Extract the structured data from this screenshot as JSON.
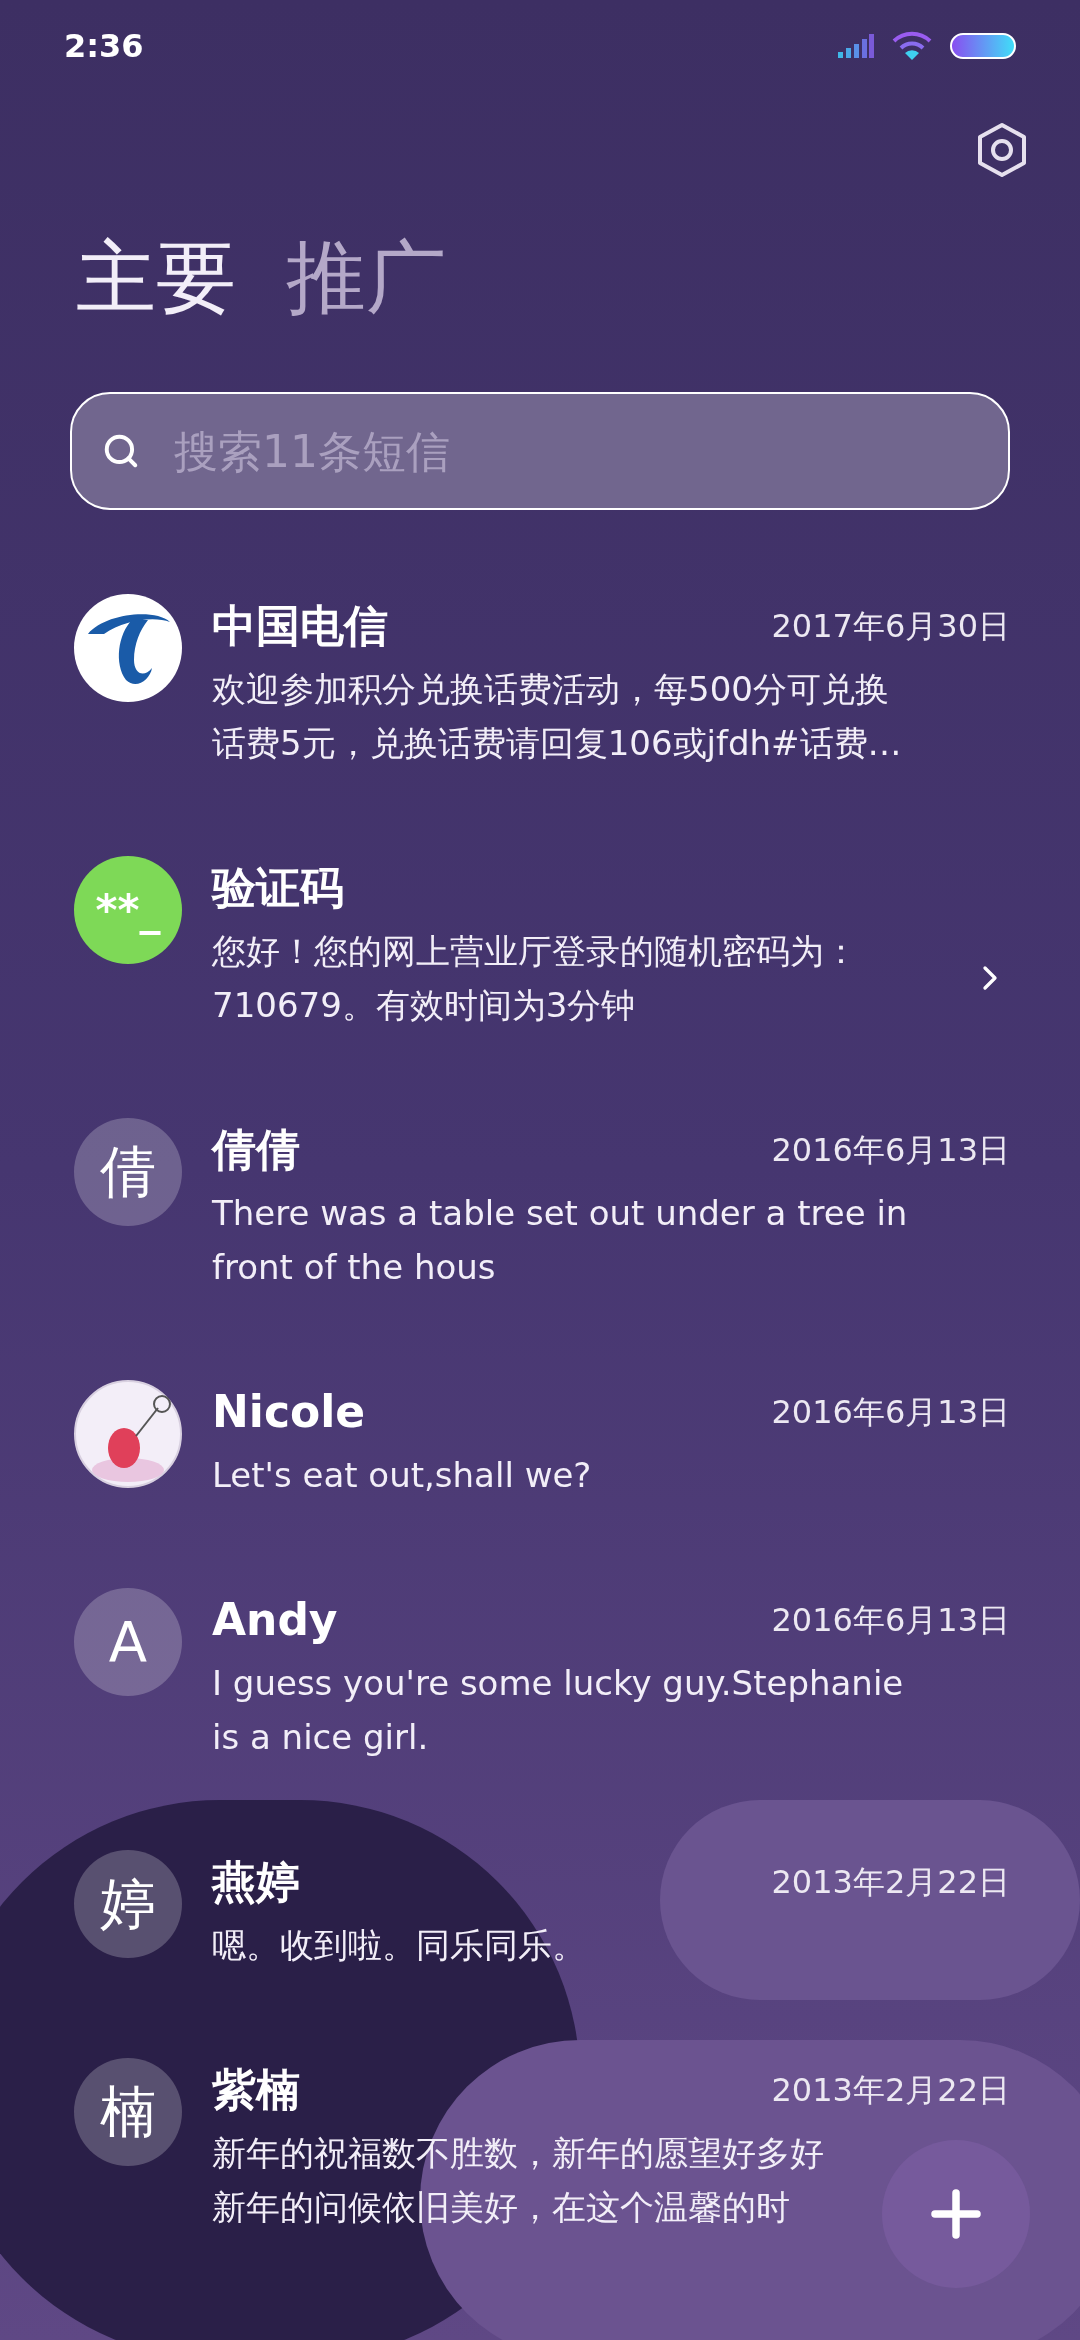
{
  "status_bar": {
    "time": "2:36"
  },
  "tabs": [
    {
      "label": "主要",
      "selected": true
    },
    {
      "label": "推广",
      "selected": false
    }
  ],
  "search": {
    "placeholder": "搜索11条短信"
  },
  "conversations": [
    {
      "avatar": {
        "kind": "logo"
      },
      "name": "中国电信",
      "date": "2017年6月30日",
      "message_lines": [
        "欢迎参加积分兑换话费活动，每500分可兑换",
        "话费5元，兑换话费请回复106或jfdh#话费…"
      ]
    },
    {
      "avatar": {
        "kind": "code",
        "text": "**_",
        "color": "#7ed957"
      },
      "name": "验证码",
      "message_lines": [
        "您好！您的网上营业厅登录的随机密码为：",
        "710679。有效时间为3分钟"
      ],
      "chevron": true
    },
    {
      "avatar": {
        "kind": "initial",
        "text": "倩"
      },
      "name": "倩倩",
      "date": "2016年6月13日",
      "message_lines": [
        "There was a table set out under a tree in",
        "front of the hous"
      ]
    },
    {
      "avatar": {
        "kind": "picture"
      },
      "name": "Nicole",
      "date": "2016年6月13日",
      "message_lines": [
        "Let's eat out,shall we?"
      ]
    },
    {
      "avatar": {
        "kind": "initial",
        "text": "A"
      },
      "name": "Andy",
      "date": "2016年6月13日",
      "message_lines": [
        "I guess you're some lucky guy.Stephanie",
        "is a nice girl."
      ]
    },
    {
      "avatar": {
        "kind": "initial",
        "text": "婷"
      },
      "name": "燕婷",
      "date": "2013年2月22日",
      "message_lines": [
        "嗯。收到啦。同乐同乐。"
      ]
    },
    {
      "avatar": {
        "kind": "initial",
        "text": "楠"
      },
      "name": "紫楠",
      "date": "2013年2月22日",
      "message_lines": [
        "新年的祝福数不胜数，新年的愿望好多好",
        "新年的问候依旧美好，在这个温馨的时"
      ]
    }
  ]
}
